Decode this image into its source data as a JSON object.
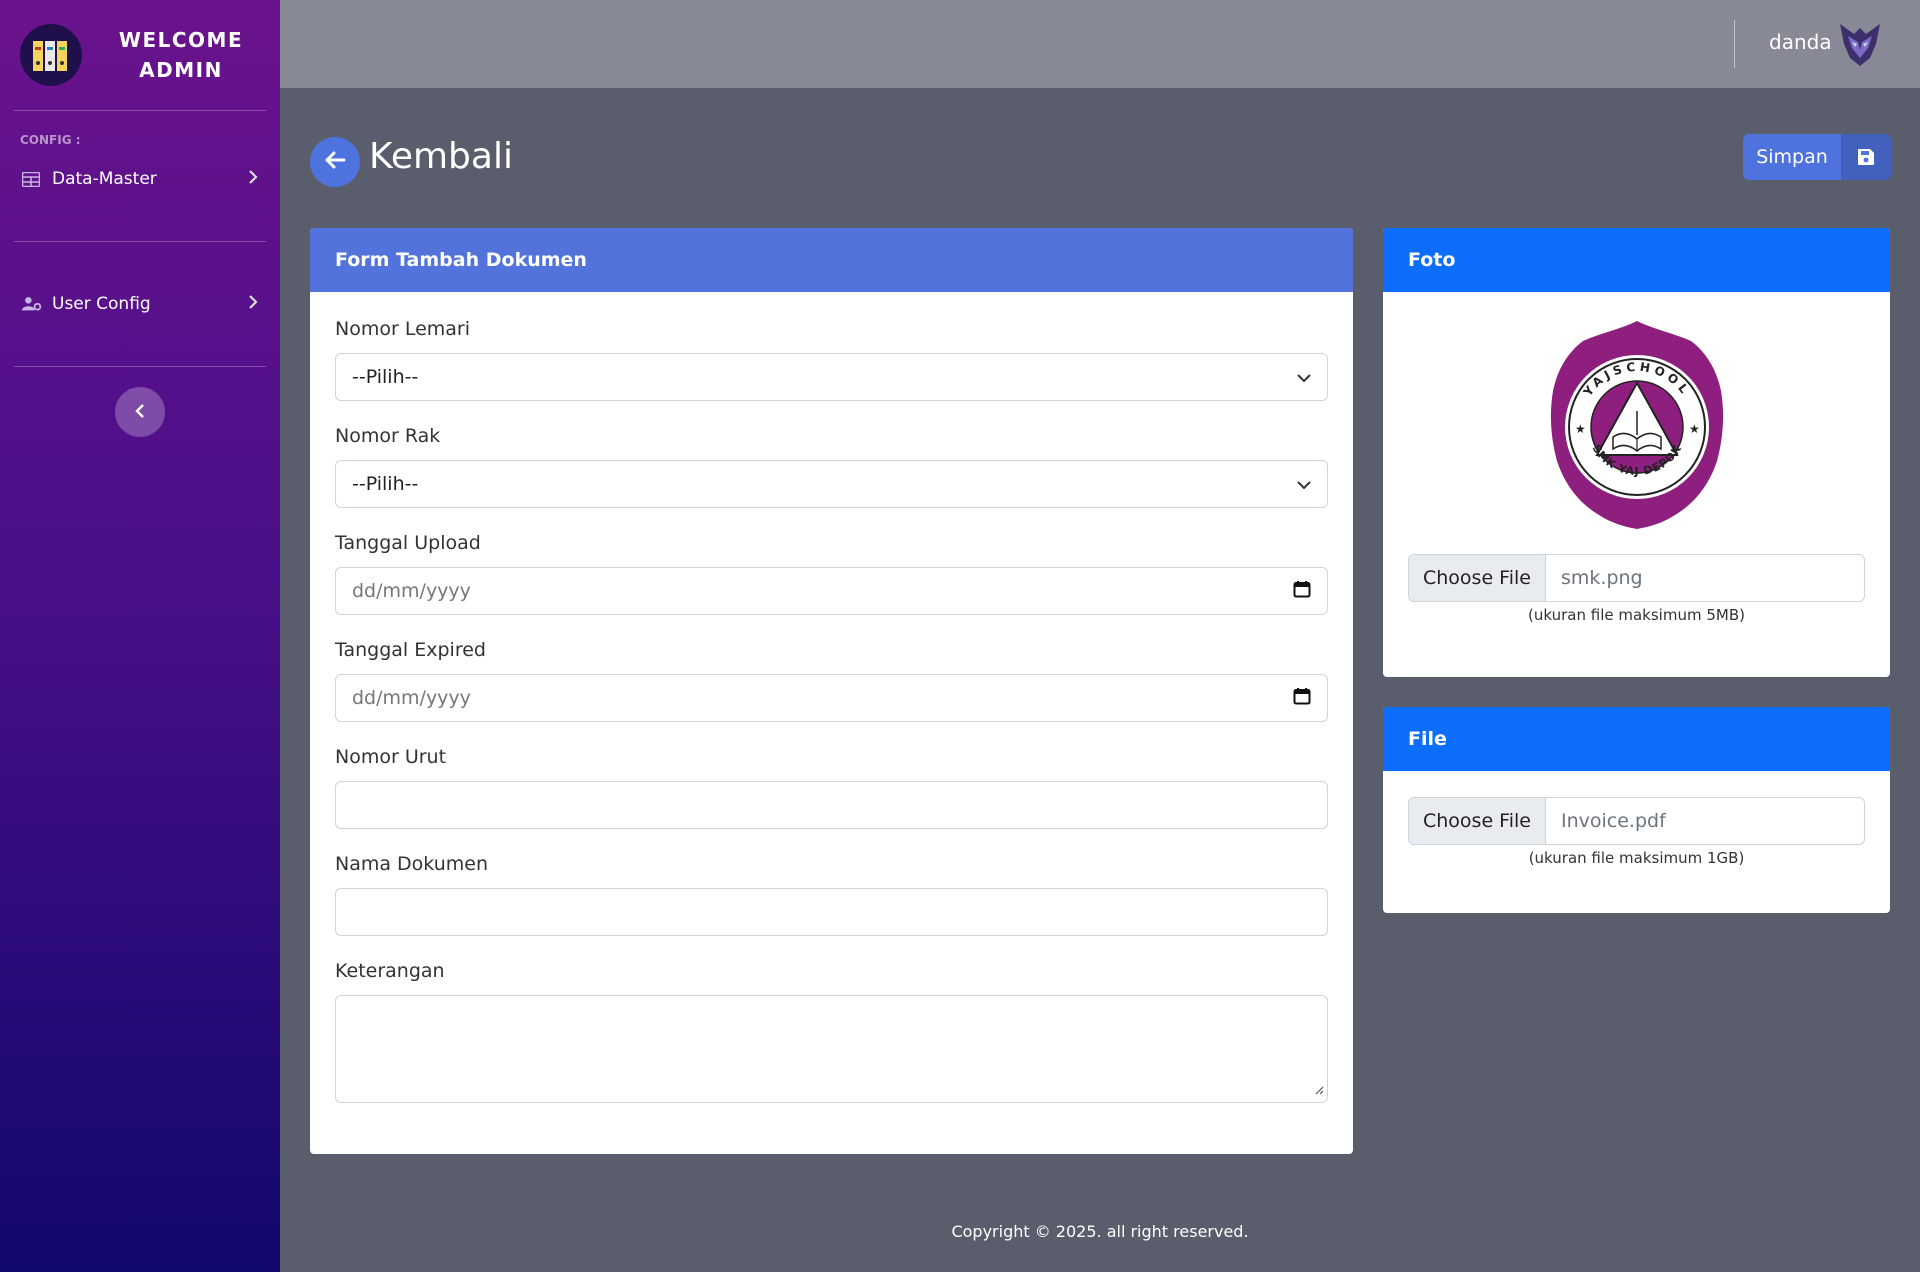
{
  "sidebar": {
    "brand_line1": "WELCOME",
    "brand_line2": "ADMIN",
    "config_heading": "CONFIG :",
    "items": [
      {
        "label": "Data-Master",
        "icon": "table-icon"
      },
      {
        "label": "User Config",
        "icon": "user-cog-icon"
      }
    ]
  },
  "topbar": {
    "user_name": "danda"
  },
  "header": {
    "title": "Kembali",
    "save_label": "Simpan"
  },
  "form": {
    "title": "Form Tambah Dokumen",
    "fields": {
      "nomor_lemari": {
        "label": "Nomor Lemari",
        "value": "--Pilih--"
      },
      "nomor_rak": {
        "label": "Nomor Rak",
        "value": "--Pilih--"
      },
      "tanggal_upload": {
        "label": "Tanggal Upload",
        "placeholder": "dd/mm/yyyy"
      },
      "tanggal_expired": {
        "label": "Tanggal Expired",
        "placeholder": "dd/mm/yyyy"
      },
      "nomor_urut": {
        "label": "Nomor Urut",
        "value": ""
      },
      "nama_dokumen": {
        "label": "Nama Dokumen",
        "value": ""
      },
      "keterangan": {
        "label": "Keterangan",
        "value": ""
      }
    }
  },
  "foto": {
    "title": "Foto",
    "logo_text_top": "YAJSCHOOL",
    "logo_text_bottom": "SMK YAJ DEPOK",
    "choose_label": "Choose File",
    "file_name": "smk.png",
    "hint": "(ukuran file maksimum 5MB)"
  },
  "file": {
    "title": "File",
    "choose_label": "Choose File",
    "file_name": "Invoice.pdf",
    "hint": "(ukuran file maksimum 1GB)"
  },
  "footer": {
    "copyright": "Copyright © 2025. all right reserved."
  },
  "colors": {
    "primary": "#4e73df",
    "card_header_blue": "#0d6efd",
    "logo_purple": "#8e1f7f"
  }
}
